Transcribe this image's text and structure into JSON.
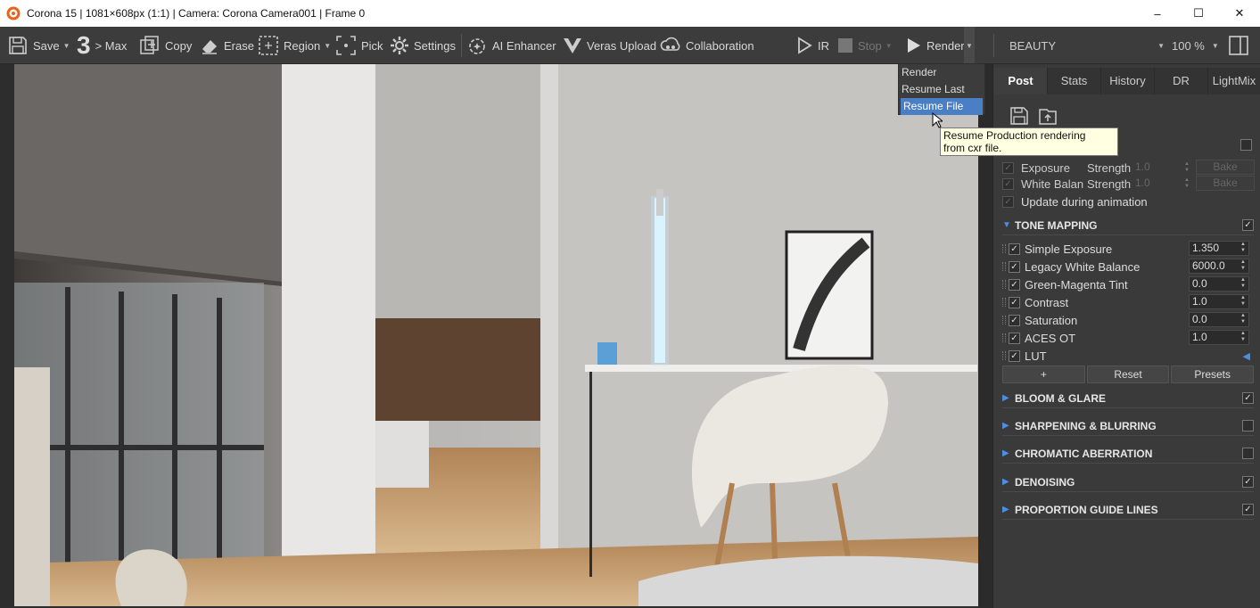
{
  "window": {
    "title": "Corona 15 | 1081×608px (1:1) | Camera: Corona Camera001 | Frame 0",
    "minimize_glyph": "–",
    "maximize_glyph": "☐",
    "close_glyph": "✕"
  },
  "toolbar": {
    "save": "Save",
    "max_number": "3",
    "max": "> Max",
    "copy": "Copy",
    "erase": "Erase",
    "region": "Region",
    "pick": "Pick",
    "settings": "Settings",
    "ai_enhancer": "AI Enhancer",
    "veras_upload": "Veras Upload",
    "collaboration": "Collaboration",
    "ir": "IR",
    "stop": "Stop",
    "render": "Render",
    "pass": "BEAUTY",
    "zoom": "100 %"
  },
  "render_menu": {
    "items": [
      "Render",
      "Resume Last",
      "Resume File"
    ],
    "selected_index": 2
  },
  "tooltip": {
    "line1": "Resume Production rendering",
    "line2": "from cxr file."
  },
  "panel": {
    "tabs": [
      "Post",
      "Stats",
      "History",
      "DR",
      "LightMix"
    ],
    "active_tab": "Post",
    "auto_rows": [
      {
        "label": "Exposure",
        "param": "Strength",
        "value": "1.0",
        "action": "Bake"
      },
      {
        "label": "White Balan",
        "param": "Strength",
        "value": "1.0",
        "action": "Bake"
      }
    ],
    "update_anim": "Update during animation",
    "tone_mapping": {
      "title": "TONE MAPPING",
      "ops": [
        {
          "label": "Simple Exposure",
          "value": "1.350"
        },
        {
          "label": "Legacy White Balance",
          "value": "6000.0"
        },
        {
          "label": "Green-Magenta Tint",
          "value": "0.0"
        },
        {
          "label": "Contrast",
          "value": "1.0"
        },
        {
          "label": "Saturation",
          "value": "0.0"
        },
        {
          "label": "ACES OT",
          "value": "1.0"
        },
        {
          "label": "LUT",
          "value": ""
        }
      ],
      "buttons": [
        "+",
        "Reset",
        "Presets"
      ]
    },
    "sections": [
      {
        "title": "BLOOM & GLARE",
        "checked": true
      },
      {
        "title": "SHARPENING & BLURRING",
        "checked": false
      },
      {
        "title": "CHROMATIC ABERRATION",
        "checked": false
      },
      {
        "title": "DENOISING",
        "checked": true
      },
      {
        "title": "PROPORTION GUIDE LINES",
        "checked": true
      }
    ]
  },
  "colors": {
    "accent": "#4a7ec5",
    "section_triangle": "#4a8fe0",
    "toolbar_bg": "#3c3c3c",
    "panel_bg": "#3a3a3a",
    "tooltip_bg": "#ffffe1"
  }
}
